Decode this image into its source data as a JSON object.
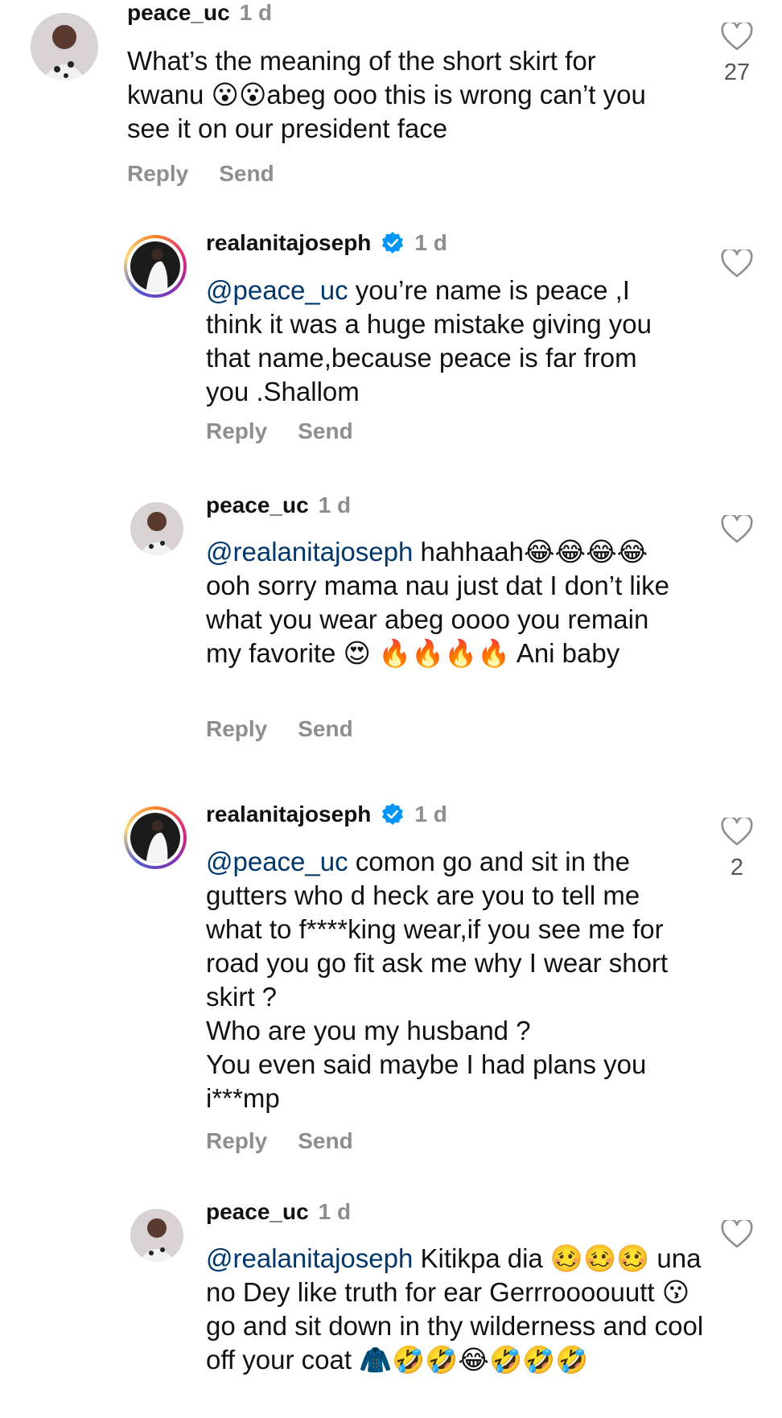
{
  "comments": [
    {
      "username": "peace_uc",
      "time": "1 d",
      "verified": false,
      "mention": "",
      "text": "What’s the meaning of the short skirt for kwanu 😮😮abeg ooo this is wrong can’t you see it on our president face",
      "likes": "27",
      "reply_label": "Reply",
      "send_label": "Send"
    },
    {
      "username": "realanitajoseph",
      "time": "1 d",
      "verified": true,
      "mention": "@peace_uc",
      "text": " you’re name is peace ,I think it was a huge mistake giving you that name,because peace is far from you .Shallom",
      "likes": "",
      "reply_label": "Reply",
      "send_label": "Send"
    },
    {
      "username": "peace_uc",
      "time": "1 d",
      "verified": false,
      "mention": "@realanitajoseph",
      "text": " hahhaah😂😂😂😂ooh sorry mama nau just dat I don’t like what you wear abeg oooo you remain my favorite 😍 🔥🔥🔥🔥 Ani baby",
      "likes": "",
      "reply_label": "Reply",
      "send_label": "Send"
    },
    {
      "username": "realanitajoseph",
      "time": "1 d",
      "verified": true,
      "mention": "@peace_uc",
      "text": " comon go and sit in the gutters who d heck are you to tell me what to f****king wear,if you see me for road you go fit ask me why I wear short skirt ?\nWho are you my husband ?\nYou even said maybe I had plans you i***mp",
      "likes": "2",
      "reply_label": "Reply",
      "send_label": "Send"
    },
    {
      "username": "peace_uc",
      "time": "1 d",
      "verified": false,
      "mention": "@realanitajoseph",
      "text": " Kitikpa dia 🥴🥴🥴 una no Dey like truth for ear Gerrroooouutt 😗 go and sit down in thy wilderness and cool off your coat 🧥🤣🤣😂🤣🤣🤣",
      "likes": "",
      "reply_label": "Reply",
      "send_label": "Send"
    }
  ],
  "colors": {
    "mention": "#00376b",
    "muted": "#8e8e8e",
    "verified": "#0095f6"
  }
}
